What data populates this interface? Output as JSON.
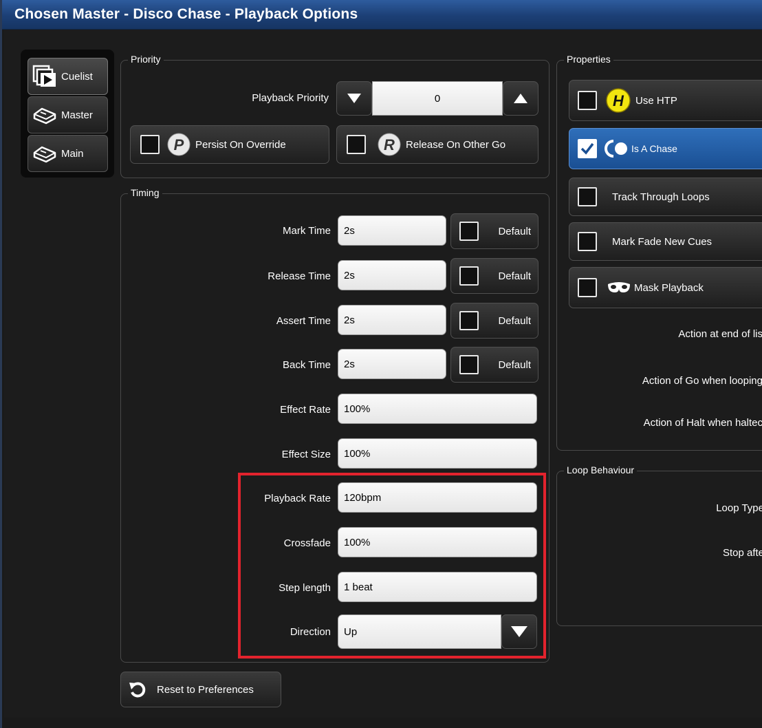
{
  "window": {
    "title": "Chosen Master - Disco Chase - Playback Options"
  },
  "tabs": [
    {
      "label": "Cuelist",
      "icon": "cuelist-icon",
      "active": true
    },
    {
      "label": "Master",
      "icon": "master-icon",
      "active": false
    },
    {
      "label": "Main",
      "icon": "main-icon",
      "active": false
    }
  ],
  "priority": {
    "group_label": "Priority",
    "playback_priority_label": "Playback Priority",
    "playback_priority_value": "0",
    "persist": {
      "label": "Persist On Override",
      "badge": "P",
      "checked": false
    },
    "release": {
      "label": "Release On Other Go",
      "badge": "R",
      "checked": false
    }
  },
  "timing": {
    "group_label": "Timing",
    "rows": [
      {
        "label": "Mark Time",
        "value": "2s",
        "default_label": "Default"
      },
      {
        "label": "Release Time",
        "value": "2s",
        "default_label": "Default"
      },
      {
        "label": "Assert Time",
        "value": "2s",
        "default_label": "Default"
      },
      {
        "label": "Back Time",
        "value": "2s",
        "default_label": "Default"
      },
      {
        "label": "Effect Rate",
        "value": "100%"
      },
      {
        "label": "Effect Size",
        "value": "100%"
      },
      {
        "label": "Playback Rate",
        "value": "120bpm"
      },
      {
        "label": "Crossfade",
        "value": "100%"
      },
      {
        "label": "Step length",
        "value": "1 beat"
      },
      {
        "label": "Direction",
        "value": "Up"
      }
    ]
  },
  "reset_button": {
    "label": "Reset to Preferences"
  },
  "properties": {
    "group_label": "Properties",
    "items": [
      {
        "label": "Use HTP",
        "checked": false,
        "badge": "H"
      },
      {
        "label": "Is A Chase",
        "checked": true
      },
      {
        "label": "Track Through Loops",
        "checked": false
      },
      {
        "label": "Mark Fade New Cues",
        "checked": false
      },
      {
        "label": "Mask Playback",
        "checked": false
      }
    ],
    "actions": [
      {
        "label": "Action at end of lis"
      },
      {
        "label": "Action of Go when looping"
      },
      {
        "label": "Action of Halt when haltec"
      }
    ]
  },
  "loop": {
    "group_label": "Loop Behaviour",
    "loop_type_label": "Loop Type",
    "stop_after_label": "Stop afte"
  },
  "colors": {
    "accent": "#2f6fba",
    "highlight": "#e2232d",
    "titlebar": "#1c3f75"
  }
}
